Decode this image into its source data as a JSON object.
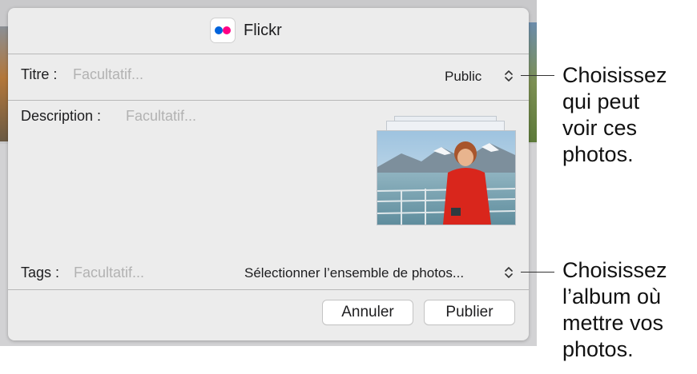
{
  "dialog": {
    "service_icon": "flickr-logo-icon",
    "service_name": "Flickr",
    "brand_colors": {
      "blue": "#0063dc",
      "pink": "#ff0084"
    }
  },
  "fields": {
    "title_label": "Titre :",
    "title_placeholder": "Facultatif...",
    "privacy_value": "Public",
    "description_label": "Description :",
    "description_placeholder": "Facultatif...",
    "tags_label": "Tags :",
    "tags_placeholder": "Facultatif...",
    "photoset_value": "Sélectionner l’ensemble de photos..."
  },
  "buttons": {
    "cancel": "Annuler",
    "publish": "Publier"
  },
  "callouts": {
    "privacy": [
      "Choisissez",
      "qui peut",
      "voir ces",
      "photos."
    ],
    "album": [
      "Choisissez",
      "l’album où",
      "mettre vos",
      "photos."
    ]
  }
}
